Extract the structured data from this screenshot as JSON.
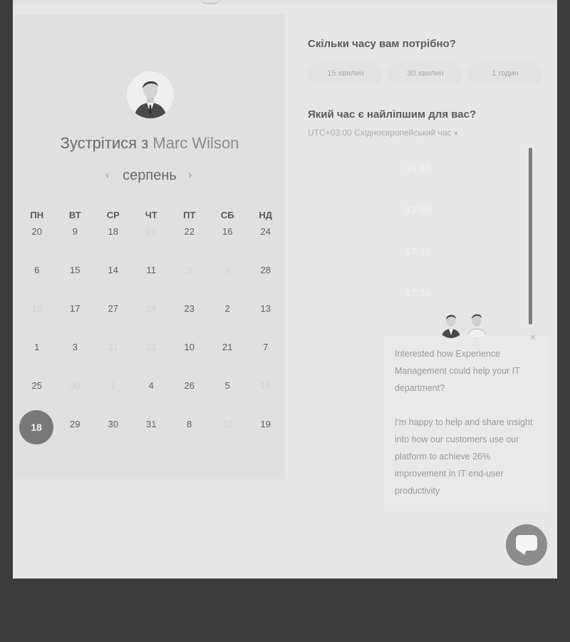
{
  "booking": {
    "meet_prefix": "Зустрітися з",
    "host_name": "Marc Wilson",
    "month": "серпень",
    "weekdays": [
      "ПН",
      "ВТ",
      "СР",
      "ЧТ",
      "ПТ",
      "СБ",
      "НД"
    ],
    "days": [
      {
        "label": "20",
        "muted": false
      },
      {
        "label": "9",
        "muted": false
      },
      {
        "label": "18",
        "muted": false
      },
      {
        "label": "19",
        "muted": true
      },
      {
        "label": "22",
        "muted": false
      },
      {
        "label": "16",
        "muted": false
      },
      {
        "label": "24",
        "muted": false
      },
      {
        "label": "6",
        "muted": false
      },
      {
        "label": "15",
        "muted": false
      },
      {
        "label": "14",
        "muted": false
      },
      {
        "label": "11",
        "muted": false
      },
      {
        "label": "3",
        "muted": true
      },
      {
        "label": "9",
        "muted": true
      },
      {
        "label": "28",
        "muted": false
      },
      {
        "label": "16",
        "muted": true
      },
      {
        "label": "17",
        "muted": false
      },
      {
        "label": "27",
        "muted": false
      },
      {
        "label": "24",
        "muted": true
      },
      {
        "label": "23",
        "muted": false
      },
      {
        "label": "2",
        "muted": false
      },
      {
        "label": "13",
        "muted": false
      },
      {
        "label": "1",
        "muted": false
      },
      {
        "label": "3",
        "muted": false
      },
      {
        "label": "31",
        "muted": true
      },
      {
        "label": "21",
        "muted": true
      },
      {
        "label": "10",
        "muted": false
      },
      {
        "label": "21",
        "muted": false
      },
      {
        "label": "7",
        "muted": false
      },
      {
        "label": "25",
        "muted": false
      },
      {
        "label": "30",
        "muted": true
      },
      {
        "label": "1",
        "muted": true
      },
      {
        "label": "4",
        "muted": false
      },
      {
        "label": "26",
        "muted": false
      },
      {
        "label": "5",
        "muted": false
      },
      {
        "label": "15",
        "muted": true
      },
      {
        "label": "18",
        "muted": false,
        "selected": true
      },
      {
        "label": "29",
        "muted": false
      },
      {
        "label": "30",
        "muted": false
      },
      {
        "label": "31",
        "muted": false
      },
      {
        "label": "8",
        "muted": false
      },
      {
        "label": "22",
        "muted": true
      },
      {
        "label": "19",
        "muted": false
      }
    ]
  },
  "duration": {
    "question": "Скільки часу вам потрібно?",
    "options": [
      "15 хвилин",
      "30 хвилин",
      "1 годин"
    ]
  },
  "time": {
    "question": "Який час є найліпшим для вас?",
    "timezone": "UTC+03:00 Східноєвропейський час",
    "slots": [
      "16:45",
      "17:00",
      "17:15",
      "17:30"
    ]
  },
  "chat": {
    "message_1": "Interested how Experience Management could help your IT department?",
    "message_2": "I'm happy to help and share insight into how our customers use our platform to achieve 26% improvement in IT end-user productivity",
    "close_glyph": "×",
    "button_icon": "chat-bubble-icon"
  },
  "icons": {
    "prev": "‹",
    "next": "›",
    "caret": "▾"
  }
}
